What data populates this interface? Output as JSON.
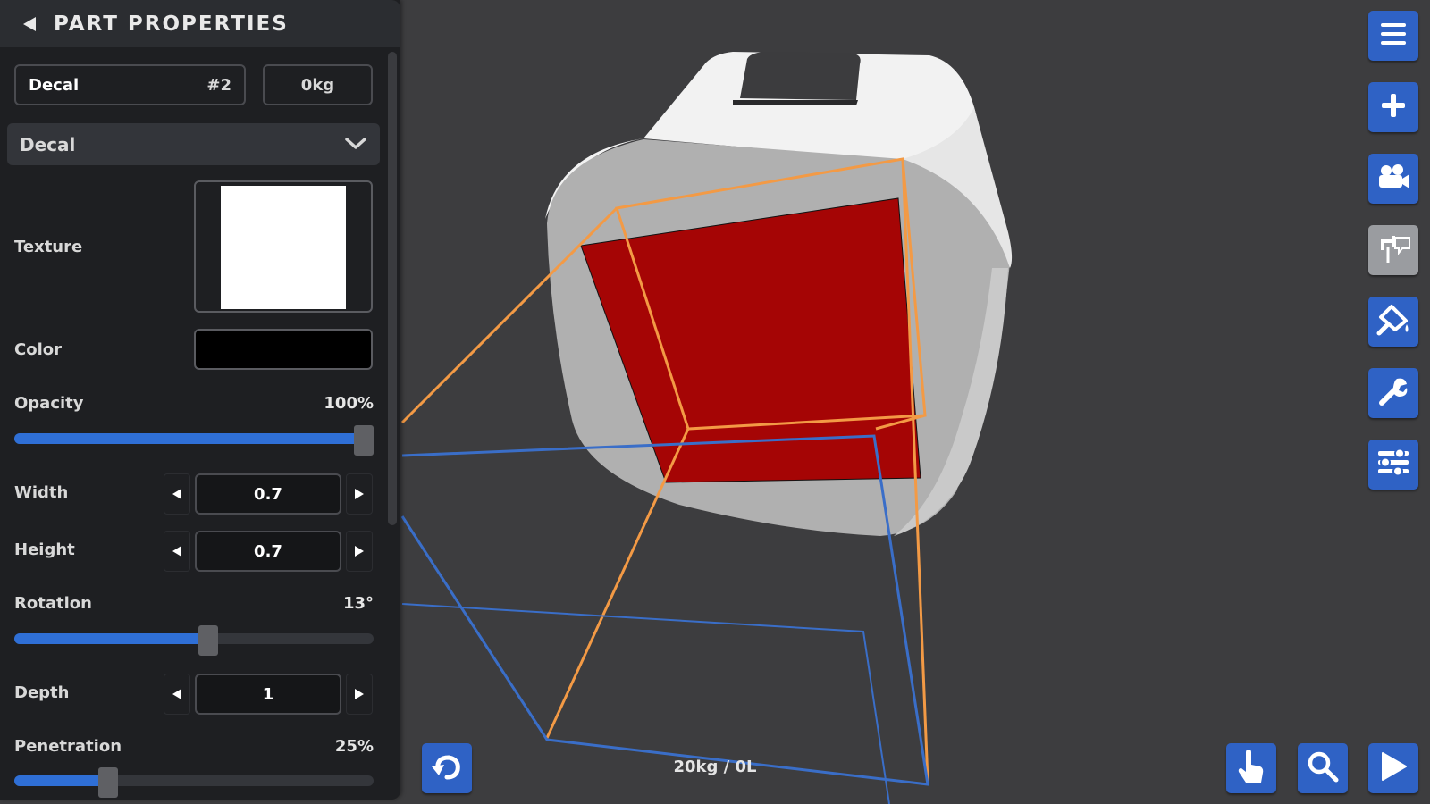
{
  "panel": {
    "title": "PART PROPERTIES",
    "part_name": "Decal",
    "part_number": "#2",
    "mass": "0kg",
    "category": "Decal",
    "texture_label": "Texture",
    "color_label": "Color",
    "color_value": "#000000",
    "opacity": {
      "label": "Opacity",
      "value": "100%",
      "level": 1.0
    },
    "width": {
      "label": "Width",
      "value": "0.7"
    },
    "height": {
      "label": "Height",
      "value": "0.7"
    },
    "rotation": {
      "label": "Rotation",
      "value": "13°",
      "level": 0.54
    },
    "depth": {
      "label": "Depth",
      "value": "1"
    },
    "penetration": {
      "label": "Penetration",
      "value": "25%",
      "level": 0.26
    }
  },
  "toolbar": {
    "icons": [
      "menu-icon",
      "plus-icon",
      "camera-icon",
      "decal-tool-icon",
      "paint-icon",
      "wrench-icon",
      "sliders-icon"
    ],
    "active": "decal-tool-icon"
  },
  "bottom_bar": {
    "readout": "20kg / 0L",
    "icons": [
      "undo-icon",
      "touch-icon",
      "search-icon",
      "play-icon"
    ]
  },
  "colors": {
    "accent": "#2f62c5",
    "decal": "#a50505",
    "gizmo_orange": "#f39a45",
    "gizmo_blue": "#3a6ec8",
    "background": "#3d3d3f"
  }
}
